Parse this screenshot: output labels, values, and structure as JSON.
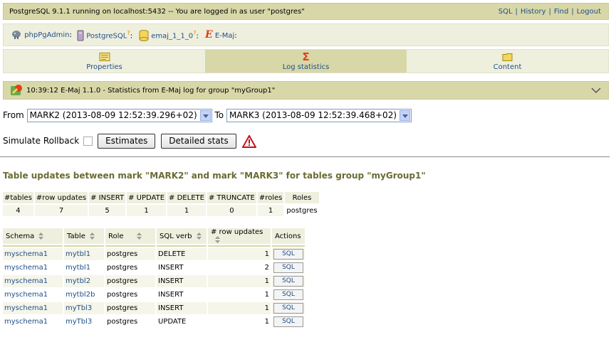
{
  "topbar": {
    "info": "PostgreSQL 9.1.1 running on localhost:5432 -- You are logged in as user \"postgres\"",
    "links": [
      "SQL",
      "History",
      "Find",
      "Logout"
    ]
  },
  "breadcrumb": {
    "app": "phpPgAdmin",
    "server": "PostgreSQL",
    "server_q": "?",
    "database": "emaj_1_1_0",
    "database_q": "?",
    "plugin": "E-Maj"
  },
  "tabs": [
    {
      "label": "Properties"
    },
    {
      "label": "Log statistics"
    },
    {
      "label": "Content"
    }
  ],
  "titlebar": {
    "text": "10:39:12  E-Maj 1.1.0  -  Statistics from E-Maj log for group \"myGroup1\""
  },
  "form": {
    "from_label": "From",
    "from_value": "MARK2 (2013-08-09 12:52:39.296+02)",
    "to_label": "To",
    "to_value": "MARK3 (2013-08-09 12:52:39.468+02)",
    "simulate_label": "Simulate Rollback",
    "estimates_label": "Estimates",
    "detailed_label": "Detailed stats"
  },
  "section_title": "Table updates between mark \"MARK2\" and mark \"MARK3\" for tables group \"myGroup1\"",
  "summary": {
    "headers": [
      "#tables",
      "#row updates",
      "# INSERT",
      "# UPDATE",
      "# DELETE",
      "# TRUNCATE",
      "#roles",
      "Roles"
    ],
    "values": [
      "4",
      "7",
      "5",
      "1",
      "1",
      "0",
      "1",
      "postgres"
    ]
  },
  "details": {
    "headers": [
      "Schema",
      "Table",
      "Role",
      "SQL verb",
      "# row updates",
      "Actions"
    ],
    "rows": [
      {
        "schema": "myschema1",
        "table": "mytbl1",
        "role": "postgres",
        "verb": "DELETE",
        "count": "1",
        "action": "SQL"
      },
      {
        "schema": "myschema1",
        "table": "mytbl1",
        "role": "postgres",
        "verb": "INSERT",
        "count": "2",
        "action": "SQL"
      },
      {
        "schema": "myschema1",
        "table": "mytbl2",
        "role": "postgres",
        "verb": "INSERT",
        "count": "1",
        "action": "SQL"
      },
      {
        "schema": "myschema1",
        "table": "mytbl2b",
        "role": "postgres",
        "verb": "INSERT",
        "count": "1",
        "action": "SQL"
      },
      {
        "schema": "myschema1",
        "table": "myTbl3",
        "role": "postgres",
        "verb": "INSERT",
        "count": "1",
        "action": "SQL"
      },
      {
        "schema": "myschema1",
        "table": "myTbl3",
        "role": "postgres",
        "verb": "UPDATE",
        "count": "1",
        "action": "SQL"
      }
    ]
  },
  "colors": {
    "header_bg": "#d8d7a8",
    "light_bg": "#efefde",
    "link": "#1f4f87",
    "title": "#6b6b32",
    "accent": "#e0401a"
  }
}
